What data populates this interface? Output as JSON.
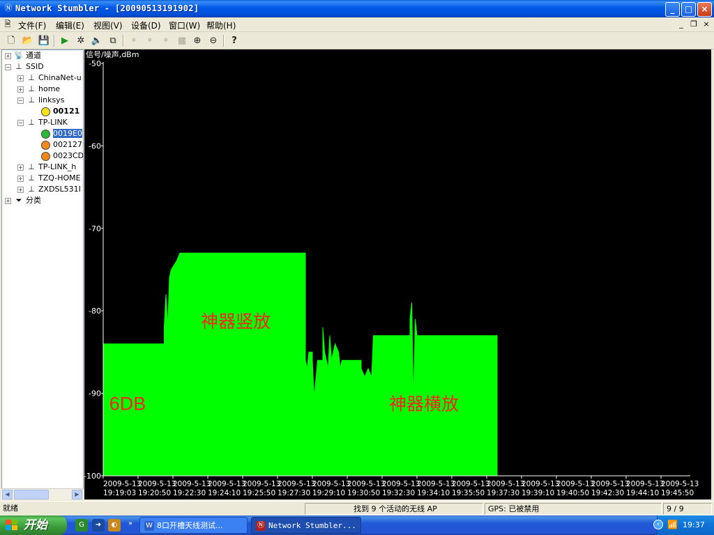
{
  "window": {
    "title": "Network Stumbler - [20090513191902]",
    "icon": "network-stumbler-icon",
    "buttons": {
      "minimize": "_",
      "maximize": "□",
      "close": "×"
    }
  },
  "menu": {
    "items": [
      {
        "id": "file",
        "label": "文件(F)"
      },
      {
        "id": "edit",
        "label": "编辑(E)"
      },
      {
        "id": "view",
        "label": "视图(V)"
      },
      {
        "id": "device",
        "label": "设备(D)"
      },
      {
        "id": "window",
        "label": "窗口(W)"
      },
      {
        "id": "help",
        "label": "帮助(H)"
      }
    ],
    "mdi_minimize": "_",
    "mdi_restore": "❐",
    "mdi_close": "×"
  },
  "toolbar": {
    "new": "🗋",
    "open": "📂",
    "save": "💾",
    "start": "▶",
    "auto_config": "✲",
    "sound": "🔈",
    "copy": "⧉",
    "dis1": "⚬",
    "dis2": "⚬",
    "dis3": "⚬",
    "dis4": "▦",
    "zoom_in": "⊕",
    "zoom_out": "⊖",
    "about": "?"
  },
  "tree": {
    "channels": "通道",
    "ssid": "SSID",
    "ssids": [
      {
        "name": "ChinaNet-u"
      },
      {
        "name": "home"
      },
      {
        "name": "linksys"
      },
      {
        "name": "00121"
      },
      {
        "name": "TP-LINK"
      },
      {
        "name": "0019E0"
      },
      {
        "name": "002127"
      },
      {
        "name": "0023CD"
      },
      {
        "name": "TP-LINK_h"
      },
      {
        "name": "TZQ-HOME"
      },
      {
        "name": "ZXDSL531I"
      }
    ],
    "filters": "分类",
    "colors": {
      "yellow": "#f5e31a",
      "green": "#2db83a",
      "orange": "#f08a1c",
      "selected": "#316ac5"
    }
  },
  "chart_data": {
    "type": "area",
    "title": "信号/噪声,dBm",
    "xlabel": "",
    "ylabel": "",
    "ylim": [
      -100,
      -50
    ],
    "yticks": [
      -50,
      -60,
      -70,
      -80,
      -90,
      -100
    ],
    "xtick_labels": [
      [
        "2009-5-13",
        "19:19:03"
      ],
      [
        "2009-5-13",
        "19:20:50"
      ],
      [
        "2009-5-13",
        "19:22:30"
      ],
      [
        "2009-5-13",
        "19:24:10"
      ],
      [
        "2009-5-13",
        "19:25:50"
      ],
      [
        "2009-5-13",
        "19:27:30"
      ],
      [
        "2009-5-13",
        "19:29:10"
      ],
      [
        "2009-5-13",
        "19:30:50"
      ],
      [
        "2009-5-13",
        "19:32:30"
      ],
      [
        "2009-5-13",
        "19:34:10"
      ],
      [
        "2009-5-13",
        "19:35:50"
      ],
      [
        "2009-5-13",
        "19:37:30"
      ],
      [
        "2009-5-13",
        "19:39:10"
      ],
      [
        "2009-5-13",
        "19:40:50"
      ],
      [
        "2009-5-13",
        "19:42:30"
      ],
      [
        "2009-5-13",
        "19:44:10"
      ],
      [
        "2009-5-13",
        "19:45:50"
      ]
    ],
    "series": [
      {
        "color": "#00ff00",
        "points": [
          [
            0.0,
            -84
          ],
          [
            1.75,
            -84
          ],
          [
            1.75,
            -82
          ],
          [
            1.8,
            -78
          ],
          [
            1.85,
            -82
          ],
          [
            1.9,
            -76
          ],
          [
            1.95,
            -75
          ],
          [
            2.1,
            -74
          ],
          [
            2.2,
            -73
          ],
          [
            5.8,
            -73
          ],
          [
            5.8,
            -86
          ],
          [
            5.85,
            -87
          ],
          [
            5.9,
            -85
          ],
          [
            6.0,
            -85
          ],
          [
            6.0,
            -86
          ],
          [
            6.05,
            -90.5
          ],
          [
            6.15,
            -86
          ],
          [
            6.3,
            -86
          ],
          [
            6.3,
            -82
          ],
          [
            6.35,
            -85
          ],
          [
            6.45,
            -87
          ],
          [
            6.5,
            -83
          ],
          [
            6.55,
            -86
          ],
          [
            6.65,
            -84
          ],
          [
            6.75,
            -85
          ],
          [
            6.8,
            -87
          ],
          [
            6.85,
            -86
          ],
          [
            7.4,
            -86
          ],
          [
            7.4,
            -87
          ],
          [
            7.5,
            -88
          ],
          [
            7.6,
            -87
          ],
          [
            7.7,
            -88
          ],
          [
            7.75,
            -83
          ],
          [
            8.8,
            -83
          ],
          [
            8.8,
            -81
          ],
          [
            8.85,
            -79
          ],
          [
            8.9,
            -91
          ],
          [
            8.95,
            -81
          ],
          [
            9.0,
            -83
          ],
          [
            11.3,
            -83
          ],
          [
            11.3,
            -100
          ]
        ]
      }
    ],
    "annotations": [
      {
        "text": "神器竖放",
        "x": 3.8,
        "y": -82,
        "color": "#ff2020"
      },
      {
        "text": "6DB",
        "x": 0.7,
        "y": -92,
        "color": "#ff2020"
      },
      {
        "text": "神器横放",
        "x": 9.2,
        "y": -92,
        "color": "#ff2020"
      }
    ]
  },
  "status": {
    "ready": "就绪",
    "found": "找到 9 个活动的无线 AP",
    "gps": "GPS: 已被禁用",
    "count": "9 / 9"
  },
  "taskbar": {
    "start": "开始",
    "quick_launch": [
      "G",
      "➜",
      "◐"
    ],
    "more": "»",
    "tasks": [
      {
        "label": "8口开槽天线测试...",
        "icon": "W"
      },
      {
        "label": "Network Stumbler...",
        "icon": "Ⓝ"
      }
    ],
    "tray_expand": "‹",
    "tray_icon": "📶",
    "clock": "19:37"
  }
}
